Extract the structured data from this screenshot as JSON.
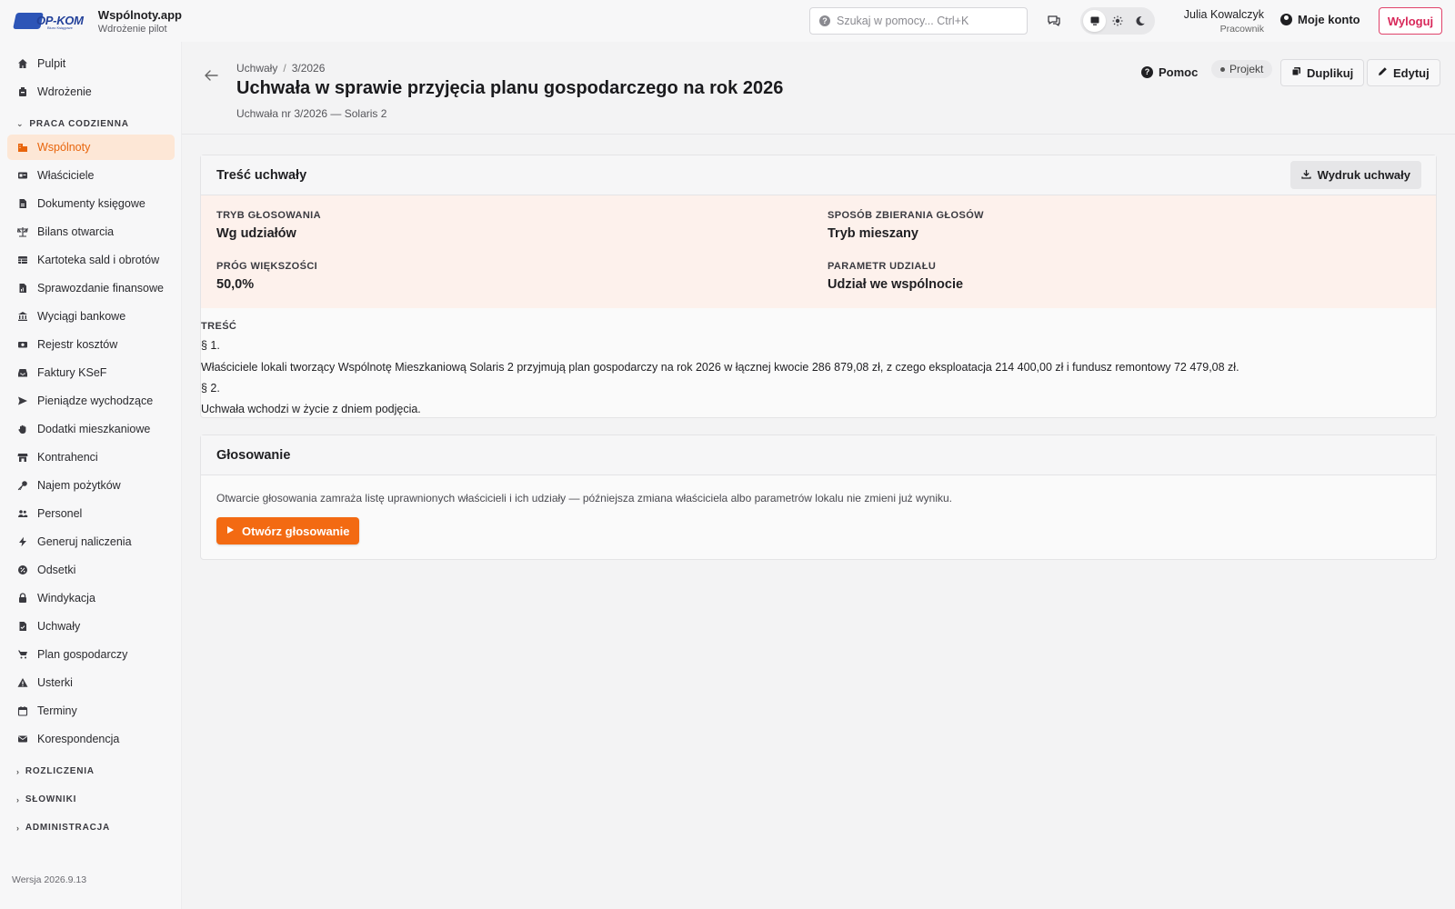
{
  "brand": {
    "logo_text": "OP-KOM",
    "logo_tagline": "Biuro Księgowe",
    "app_name": "Wspólnoty.app",
    "env": "Wdrożenie pilot"
  },
  "search": {
    "placeholder": "Szukaj w pomocy... Ctrl+K"
  },
  "user": {
    "name": "Julia Kowalczyk",
    "role": "Pracownik",
    "account_label": "Moje konto",
    "logout_label": "Wyloguj"
  },
  "theme": {
    "options": [
      "monitor-icon",
      "sun-icon",
      "moon-icon"
    ],
    "active": "monitor-icon"
  },
  "sidebar": {
    "top_items": [
      {
        "label": "Pulpit",
        "icon": "home-icon"
      },
      {
        "label": "Wdrożenie",
        "icon": "rocket-icon"
      }
    ],
    "section_daily": "PRACA CODZIENNA",
    "items": [
      {
        "label": "Wspólnoty",
        "icon": "building-icon",
        "active": true
      },
      {
        "label": "Właściciele",
        "icon": "id-card-icon"
      },
      {
        "label": "Dokumenty księgowe",
        "icon": "document-icon"
      },
      {
        "label": "Bilans otwarcia",
        "icon": "scale-icon"
      },
      {
        "label": "Kartoteka sald i obrotów",
        "icon": "table-icon"
      },
      {
        "label": "Sprawozdanie finansowe",
        "icon": "report-icon"
      },
      {
        "label": "Wyciągi bankowe",
        "icon": "bank-icon"
      },
      {
        "label": "Rejestr kosztów",
        "icon": "money-icon"
      },
      {
        "label": "Faktury KSeF",
        "icon": "inbox-icon"
      },
      {
        "label": "Pieniądze wychodzące",
        "icon": "send-icon"
      },
      {
        "label": "Dodatki mieszkaniowe",
        "icon": "hand-icon"
      },
      {
        "label": "Kontrahenci",
        "icon": "store-icon"
      },
      {
        "label": "Najem pożytków",
        "icon": "key-icon"
      },
      {
        "label": "Personel",
        "icon": "users-icon"
      },
      {
        "label": "Generuj naliczenia",
        "icon": "bolt-icon"
      },
      {
        "label": "Odsetki",
        "icon": "percent-icon"
      },
      {
        "label": "Windykacja",
        "icon": "lock-icon"
      },
      {
        "label": "Uchwały",
        "icon": "check-doc-icon"
      },
      {
        "label": "Plan gospodarczy",
        "icon": "chart-icon"
      },
      {
        "label": "Usterki",
        "icon": "warning-icon"
      },
      {
        "label": "Terminy",
        "icon": "calendar-icon"
      },
      {
        "label": "Korespondencja",
        "icon": "mail-icon"
      }
    ],
    "sections_collapsed": [
      "ROZLICZENIA",
      "SŁOWNIKI",
      "ADMINISTRACJA"
    ],
    "version": "Wersja 2026.9.13"
  },
  "header": {
    "breadcrumb": [
      "Uchwały",
      "3/2026"
    ],
    "title": "Uchwała w sprawie przyjęcia planu gospodarczego na rok 2026",
    "subtitle": "Uchwała nr 3/2026 — Solaris 2",
    "help_label": "Pomoc",
    "status_badge": "Projekt",
    "duplicate_label": "Duplikuj",
    "edit_label": "Edytuj"
  },
  "resolution": {
    "card_title": "Treść uchwały",
    "print_label": "Wydruk uchwały",
    "params": [
      {
        "label": "TRYB GŁOSOWANIA",
        "value": "Wg udziałów"
      },
      {
        "label": "SPOSÓB ZBIERANIA GŁOSÓW",
        "value": "Tryb mieszany"
      },
      {
        "label": "PRÓG WIĘKSZOŚCI",
        "value": "50,0%"
      },
      {
        "label": "PARAMETR UDZIAŁU",
        "value": "Udział we wspólnocie"
      }
    ],
    "content_label": "TREŚĆ",
    "content_lines": [
      "§ 1.",
      "Właściciele lokali tworzący Wspólnotę Mieszkaniową Solaris 2 przyjmują plan gospodarczy na rok 2026 w łącznej kwocie 286 879,08 zł, z czego eksploatacja 214 400,00 zł i fundusz remontowy 72 479,08 zł.",
      "§ 2.",
      "Uchwała wchodzi w życie z dniem podjęcia."
    ]
  },
  "voting": {
    "card_title": "Głosowanie",
    "description": "Otwarcie głosowania zamraża listę uprawnionych właścicieli i ich udziały — późniejsza zmiana właściciela albo parametrów lokalu nie zmieni już wyniku.",
    "open_label": "Otwórz głosowanie"
  },
  "colors": {
    "accent": "#f36a12",
    "active_bg": "#fde7d6",
    "logout": "#d8285a",
    "params_bg": "#fdf1ec"
  }
}
